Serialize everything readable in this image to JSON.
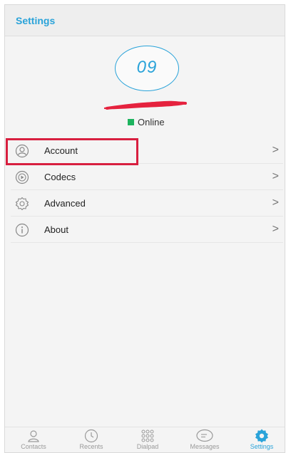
{
  "header": {
    "title": "Settings"
  },
  "profile": {
    "avatar_text": "09",
    "status": "Online",
    "status_color": "#1db35e"
  },
  "menu": {
    "items": [
      {
        "label": "Account",
        "icon": "user-icon"
      },
      {
        "label": "Codecs",
        "icon": "play-icon"
      },
      {
        "label": "Advanced",
        "icon": "gear-icon"
      },
      {
        "label": "About",
        "icon": "info-icon"
      }
    ]
  },
  "tabs": [
    {
      "label": "Contacts",
      "icon": "person-icon",
      "active": false
    },
    {
      "label": "Recents",
      "icon": "clock-icon",
      "active": false
    },
    {
      "label": "Dialpad",
      "icon": "dialpad-icon",
      "active": false
    },
    {
      "label": "Messages",
      "icon": "message-icon",
      "active": false
    },
    {
      "label": "Settings",
      "icon": "gear-icon",
      "active": true
    }
  ],
  "colors": {
    "accent": "#2aa3d9",
    "highlight_border": "#d81f3f"
  }
}
